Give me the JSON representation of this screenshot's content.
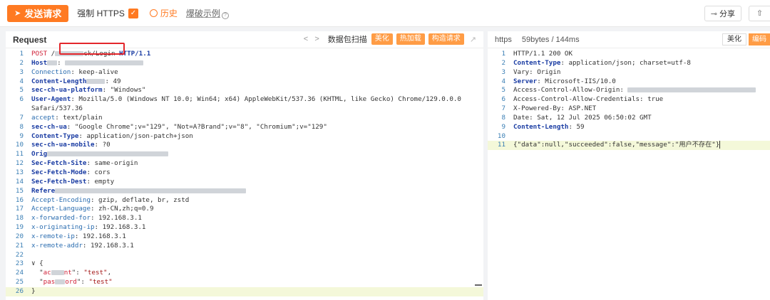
{
  "toolbar": {
    "send_label": "发送请求",
    "force_https_label": "强制 HTTPS",
    "history_label": "历史",
    "examples_label": "爆破示例",
    "share_label": "分享"
  },
  "request": {
    "title": "Request",
    "scan_label": "数据包扫描",
    "beautify_label": "美化",
    "hotload_label": "热加载",
    "build_label": "构造请求",
    "lines": [
      {
        "n": "1",
        "parts": [
          {
            "c": "red",
            "t": "POST"
          },
          {
            "c": "plain",
            "t": " /"
          },
          {
            "c": "blur",
            "w": 40
          },
          {
            "c": "plain",
            "t": "ck/Login "
          },
          {
            "c": "k",
            "t": "HTTP/1.1"
          }
        ]
      },
      {
        "n": "2",
        "parts": [
          {
            "c": "k",
            "t": "Host"
          },
          {
            "c": "blur",
            "w": 14
          },
          {
            "c": "plain",
            "t": ": "
          },
          {
            "c": "blur",
            "w": 110
          }
        ]
      },
      {
        "n": "3",
        "parts": [
          {
            "c": "h",
            "t": "Connection"
          },
          {
            "c": "plain",
            "t": ": keep-alive"
          }
        ]
      },
      {
        "n": "4",
        "parts": [
          {
            "c": "k",
            "t": "Content-Length"
          },
          {
            "c": "blur",
            "w": 26
          },
          {
            "c": "plain",
            "t": ": 49"
          }
        ]
      },
      {
        "n": "5",
        "parts": [
          {
            "c": "k",
            "t": "sec-ch-ua-platform"
          },
          {
            "c": "plain",
            "t": ": \"Windows\""
          }
        ]
      },
      {
        "n": "6",
        "parts": [
          {
            "c": "k",
            "t": "User-Agent"
          },
          {
            "c": "plain",
            "t": ": Mozilla/5.0 (Windows NT 10.0; Win64; x64) AppleWebKit/537.36 (KHTML, like Gecko) Chrome/129.0.0.0"
          }
        ]
      },
      {
        "n": "",
        "parts": [
          {
            "c": "plain",
            "t": "Safari/537.36"
          }
        ]
      },
      {
        "n": "7",
        "parts": [
          {
            "c": "h",
            "t": "accept"
          },
          {
            "c": "plain",
            "t": ": text/plain"
          }
        ]
      },
      {
        "n": "8",
        "parts": [
          {
            "c": "k",
            "t": "sec-ch-ua"
          },
          {
            "c": "plain",
            "t": ": \"Google Chrome\";v=\"129\", \"Not=A?Brand\";v=\"8\", \"Chromium\";v=\"129\""
          }
        ]
      },
      {
        "n": "9",
        "parts": [
          {
            "c": "k",
            "t": "Content-Type"
          },
          {
            "c": "plain",
            "t": ": application/json-patch+json"
          }
        ]
      },
      {
        "n": "10",
        "parts": [
          {
            "c": "k",
            "t": "sec-ch-ua-mobile"
          },
          {
            "c": "plain",
            "t": ": ?0"
          }
        ]
      },
      {
        "n": "11",
        "parts": [
          {
            "c": "k",
            "t": "Orig"
          },
          {
            "c": "blur",
            "w": 170
          }
        ]
      },
      {
        "n": "12",
        "parts": [
          {
            "c": "k",
            "t": "Sec-Fetch-Site"
          },
          {
            "c": "plain",
            "t": ": same-origin"
          }
        ]
      },
      {
        "n": "13",
        "parts": [
          {
            "c": "k",
            "t": "Sec-Fetch-Mode"
          },
          {
            "c": "plain",
            "t": ": cors"
          }
        ]
      },
      {
        "n": "14",
        "parts": [
          {
            "c": "k",
            "t": "Sec-Fetch-Dest"
          },
          {
            "c": "plain",
            "t": ": empty"
          }
        ]
      },
      {
        "n": "15",
        "parts": [
          {
            "c": "k",
            "t": "Refere"
          },
          {
            "c": "blur",
            "w": 268
          }
        ]
      },
      {
        "n": "16",
        "parts": [
          {
            "c": "h",
            "t": "Accept-Encoding"
          },
          {
            "c": "plain",
            "t": ": gzip, deflate, br, zstd"
          }
        ]
      },
      {
        "n": "17",
        "parts": [
          {
            "c": "h",
            "t": "Accept-Language"
          },
          {
            "c": "plain",
            "t": ": zh-CN,zh;q=0.9"
          }
        ]
      },
      {
        "n": "18",
        "parts": [
          {
            "c": "h",
            "t": "x-forwarded-for"
          },
          {
            "c": "plain",
            "t": ": 192.168.3.1"
          }
        ]
      },
      {
        "n": "19",
        "parts": [
          {
            "c": "h",
            "t": "x-originating-ip"
          },
          {
            "c": "plain",
            "t": ": 192.168.3.1"
          }
        ]
      },
      {
        "n": "20",
        "parts": [
          {
            "c": "h",
            "t": "x-remote-ip"
          },
          {
            "c": "plain",
            "t": ": 192.168.3.1"
          }
        ]
      },
      {
        "n": "21",
        "parts": [
          {
            "c": "h",
            "t": "x-remote-addr"
          },
          {
            "c": "plain",
            "t": ": 192.168.3.1"
          }
        ]
      },
      {
        "n": "22",
        "parts": []
      },
      {
        "n": "23",
        "parts": [
          {
            "c": "plain",
            "t": "∨ {"
          }
        ]
      },
      {
        "n": "24",
        "parts": [
          {
            "c": "plain",
            "t": "  \""
          },
          {
            "c": "red",
            "t": "ac"
          },
          {
            "c": "blur",
            "w": 18
          },
          {
            "c": "red",
            "t": "nt"
          },
          {
            "c": "plain",
            "t": "\": "
          },
          {
            "c": "str",
            "t": "\"test\""
          },
          {
            "c": "plain",
            "t": ","
          }
        ]
      },
      {
        "n": "25",
        "parts": [
          {
            "c": "plain",
            "t": "  \""
          },
          {
            "c": "red",
            "t": "pas"
          },
          {
            "c": "blur",
            "w": 14
          },
          {
            "c": "red",
            "t": "ord"
          },
          {
            "c": "plain",
            "t": "\": "
          },
          {
            "c": "str",
            "t": "\"test\""
          }
        ]
      },
      {
        "n": "26",
        "active": true,
        "parts": [
          {
            "c": "plain",
            "t": "}"
          }
        ]
      }
    ]
  },
  "response": {
    "tab_https": "https",
    "tab_size": "59bytes / 144ms",
    "beautify_label": "美化",
    "encode_label": "编码",
    "lines": [
      {
        "n": "1",
        "parts": [
          {
            "c": "plain",
            "t": "HTTP/1.1 200 OK"
          }
        ]
      },
      {
        "n": "2",
        "parts": [
          {
            "c": "k",
            "t": "Content-Type"
          },
          {
            "c": "plain",
            "t": ": application/json; charset=utf-8"
          }
        ]
      },
      {
        "n": "3",
        "parts": [
          {
            "c": "plain",
            "t": "Vary: Origin"
          }
        ]
      },
      {
        "n": "4",
        "parts": [
          {
            "c": "k",
            "t": "Server"
          },
          {
            "c": "plain",
            "t": ": Microsoft-IIS/10.0"
          }
        ]
      },
      {
        "n": "5",
        "parts": [
          {
            "c": "plain",
            "t": "Access-Control-Allow-Origin: "
          },
          {
            "c": "blur",
            "w": 180
          }
        ]
      },
      {
        "n": "6",
        "parts": [
          {
            "c": "plain",
            "t": "Access-Control-Allow-Credentials: true"
          }
        ]
      },
      {
        "n": "7",
        "parts": [
          {
            "c": "plain",
            "t": "X-Powered-By: ASP.NET"
          }
        ]
      },
      {
        "n": "8",
        "parts": [
          {
            "c": "plain",
            "t": "Date: Sat, 12 Jul 2025 06:50:02 GMT"
          }
        ]
      },
      {
        "n": "9",
        "parts": [
          {
            "c": "k",
            "t": "Content-Length"
          },
          {
            "c": "plain",
            "t": ": 59"
          }
        ]
      },
      {
        "n": "10",
        "parts": []
      },
      {
        "n": "11",
        "active": true,
        "parts": [
          {
            "c": "plain",
            "t": "{\"data\":null,\"succeeded\":false,\"message\":\"用户不存在\"}"
          }
        ]
      }
    ]
  }
}
